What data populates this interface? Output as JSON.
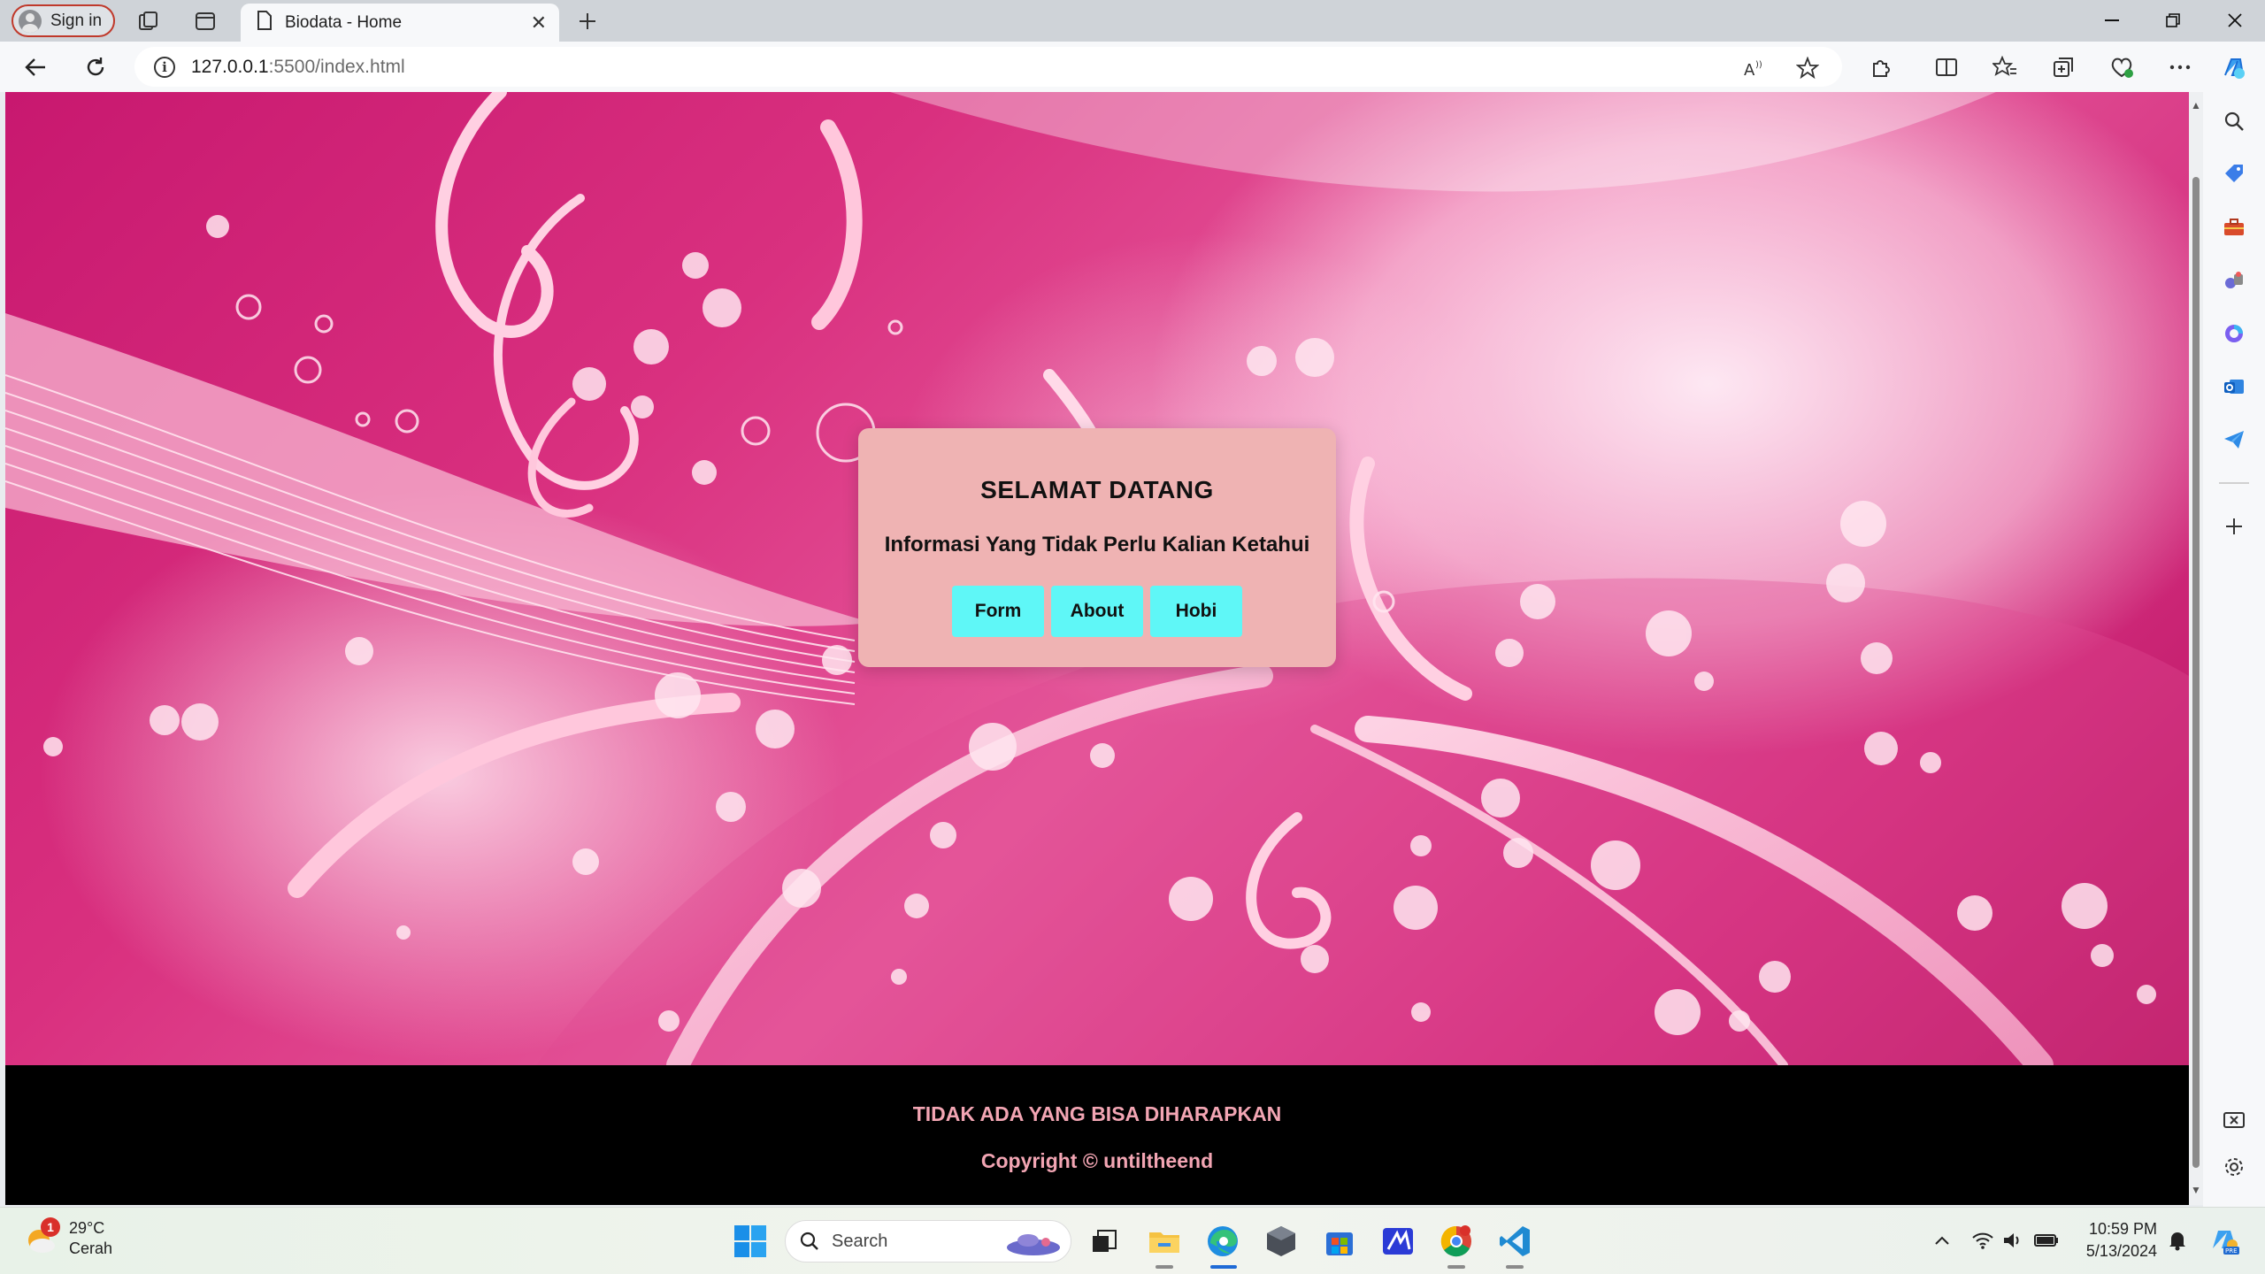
{
  "browser": {
    "sign_in_label": "Sign in",
    "tab_title": "Biodata - Home",
    "url_host": "127.0.0.1",
    "url_path": ":5500/index.html"
  },
  "page": {
    "welcome_title": "SELAMAT DATANG",
    "welcome_subtitle": "Informasi Yang Tidak Perlu Kalian Ketahui",
    "buttons": [
      {
        "label": "Form"
      },
      {
        "label": "About"
      },
      {
        "label": "Hobi"
      }
    ],
    "footer_line1": "TIDAK ADA YANG BISA DIHARAPKAN",
    "footer_line2": "Copyright © untiltheend"
  },
  "taskbar": {
    "weather_temp": "29°C",
    "weather_desc": "Cerah",
    "weather_badge": "1",
    "search_placeholder": "Search",
    "time": "10:59 PM",
    "date": "5/13/2024"
  },
  "colors": {
    "card_bg": "#efb3b3",
    "button_bg": "#5ff7f7",
    "footer_bg": "#000000",
    "footer_text": "#f2a5b3"
  }
}
